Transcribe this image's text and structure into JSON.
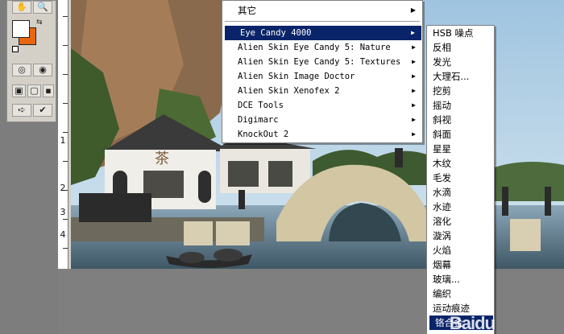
{
  "ruler": {
    "labels": [
      "1",
      "2",
      "3",
      "4"
    ]
  },
  "menu_main": {
    "items": [
      {
        "label": "其它",
        "has_submenu": true
      },
      {
        "label": "Eye Candy 4000",
        "has_submenu": true,
        "selected": true
      },
      {
        "label": "Alien Skin Eye Candy 5: Nature",
        "has_submenu": true
      },
      {
        "label": "Alien Skin Eye Candy 5: Textures",
        "has_submenu": true
      },
      {
        "label": "Alien Skin Image Doctor",
        "has_submenu": true
      },
      {
        "label": "Alien Skin Xenofex 2",
        "has_submenu": true
      },
      {
        "label": "DCE Tools",
        "has_submenu": true
      },
      {
        "label": "Digimarc",
        "has_submenu": true
      },
      {
        "label": "KnockOut 2",
        "has_submenu": true
      }
    ]
  },
  "menu_sub": {
    "items": [
      "HSB 噪点",
      "反相",
      "发光",
      "大理石...",
      "挖剪",
      "摇动",
      "斜视",
      "斜面",
      "星星",
      "木纹",
      "毛发",
      "水滴",
      "水迹",
      "溶化",
      "漩涡",
      "火焰",
      "烟幕",
      "玻璃...",
      "编织",
      "运动痕迹",
      "铬合金"
    ],
    "selected_index": 20
  },
  "photo": {
    "sign_text": "茶"
  },
  "watermark": "Baidu",
  "colors": {
    "foreground": "#ffffff",
    "background": "#e8660f",
    "menu_highlight": "#0a246a"
  }
}
